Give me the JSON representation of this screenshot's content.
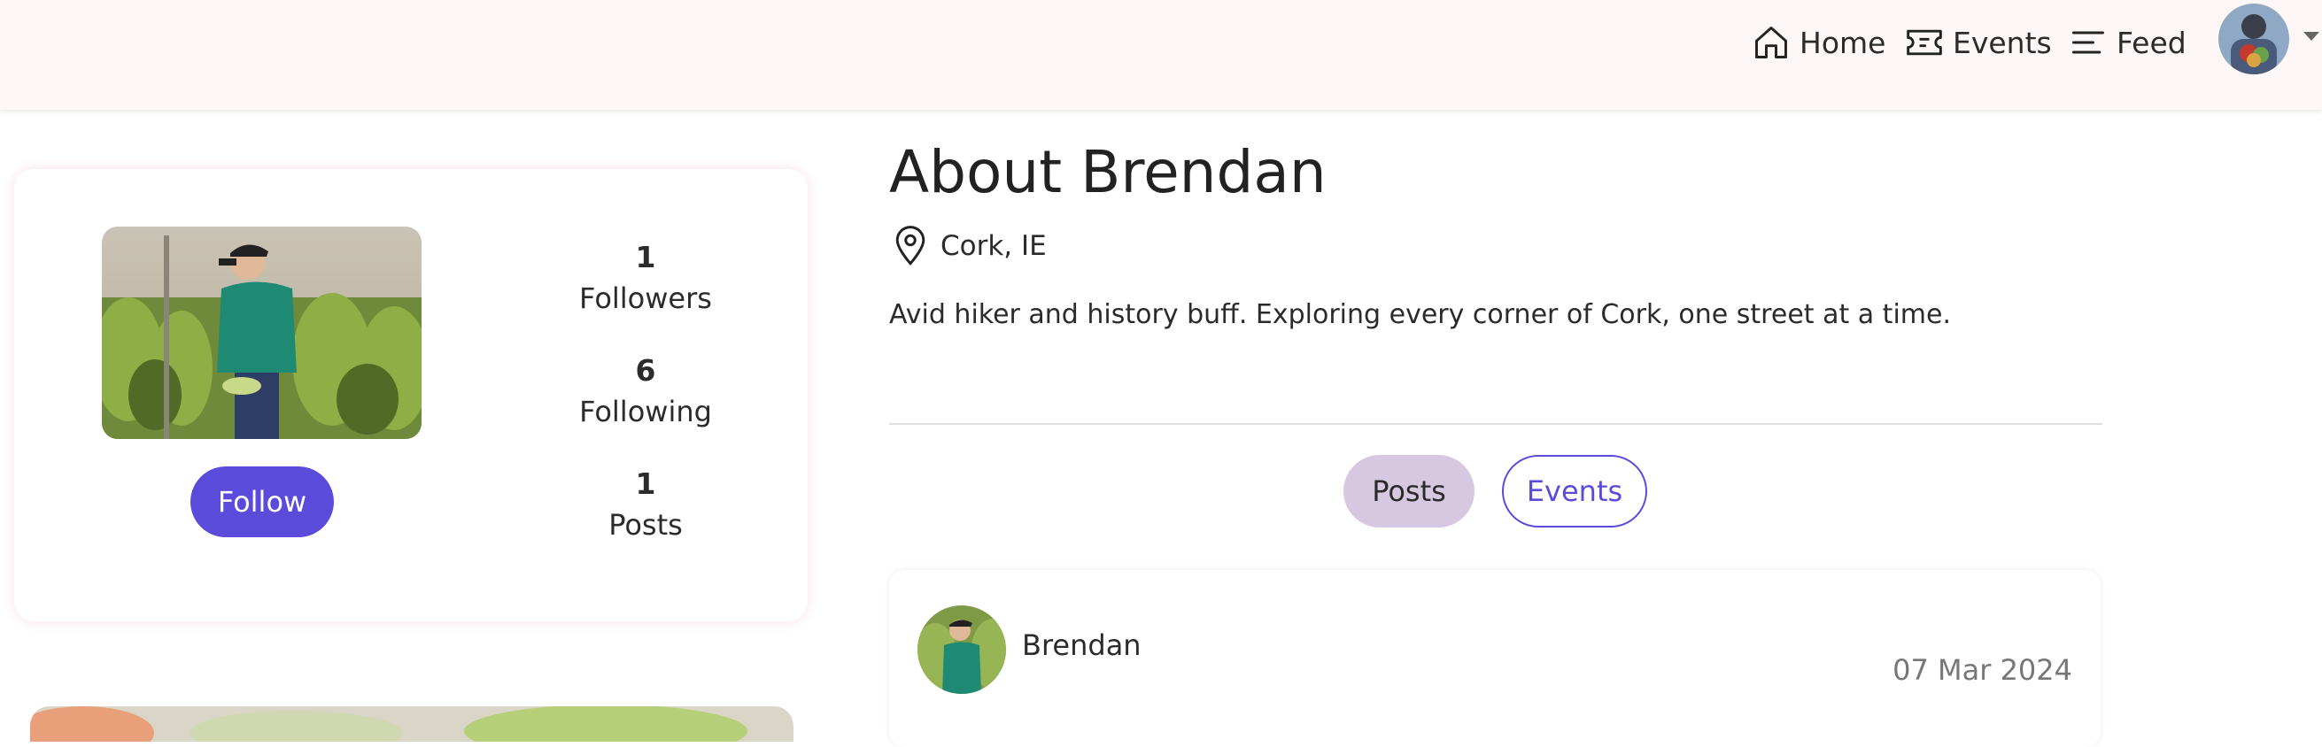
{
  "nav": {
    "home_label": "Home",
    "events_label": "Events",
    "feed_label": "Feed"
  },
  "profile": {
    "follow_label": "Follow",
    "stats": [
      {
        "value": "1",
        "label": "Followers"
      },
      {
        "value": "6",
        "label": "Following"
      },
      {
        "value": "1",
        "label": "Posts"
      }
    ]
  },
  "about": {
    "title": "About Brendan",
    "location": "Cork, IE",
    "bio": "Avid hiker and history buff. Exploring every corner of Cork, one street at a time."
  },
  "tabs": {
    "posts_label": "Posts",
    "events_label": "Events",
    "active": "Posts"
  },
  "post": {
    "author": "Brendan",
    "date": "07 Mar 2024"
  },
  "colors": {
    "accent": "#5b4bdb",
    "active_tab": "#d6c8e0",
    "topbar": "#fdf8f7"
  },
  "icons": {
    "home": "home-icon",
    "events": "ticket-icon",
    "feed": "feed-lines-icon",
    "location": "map-pin-icon"
  }
}
